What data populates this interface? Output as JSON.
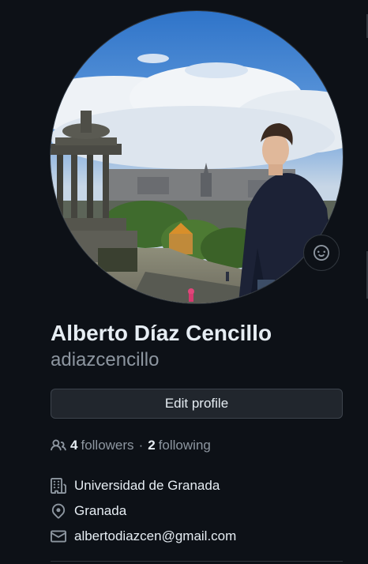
{
  "profile": {
    "full_name": "Alberto Díaz Cencillo",
    "username": "adiazcencillo",
    "avatar_icon": "profile-photo",
    "status_icon": "smiley-icon"
  },
  "actions": {
    "edit_profile_label": "Edit profile"
  },
  "social": {
    "followers_count": "4",
    "followers_label": "followers",
    "separator": "·",
    "following_count": "2",
    "following_label": "following"
  },
  "details": {
    "organization": "Universidad de Granada",
    "location": "Granada",
    "email": "albertodiazcen@gmail.com"
  },
  "colors": {
    "background": "#0d1117",
    "text_primary": "#e6edf3",
    "text_muted": "#8d96a0",
    "button_bg": "#21262d",
    "border": "#30363d"
  }
}
